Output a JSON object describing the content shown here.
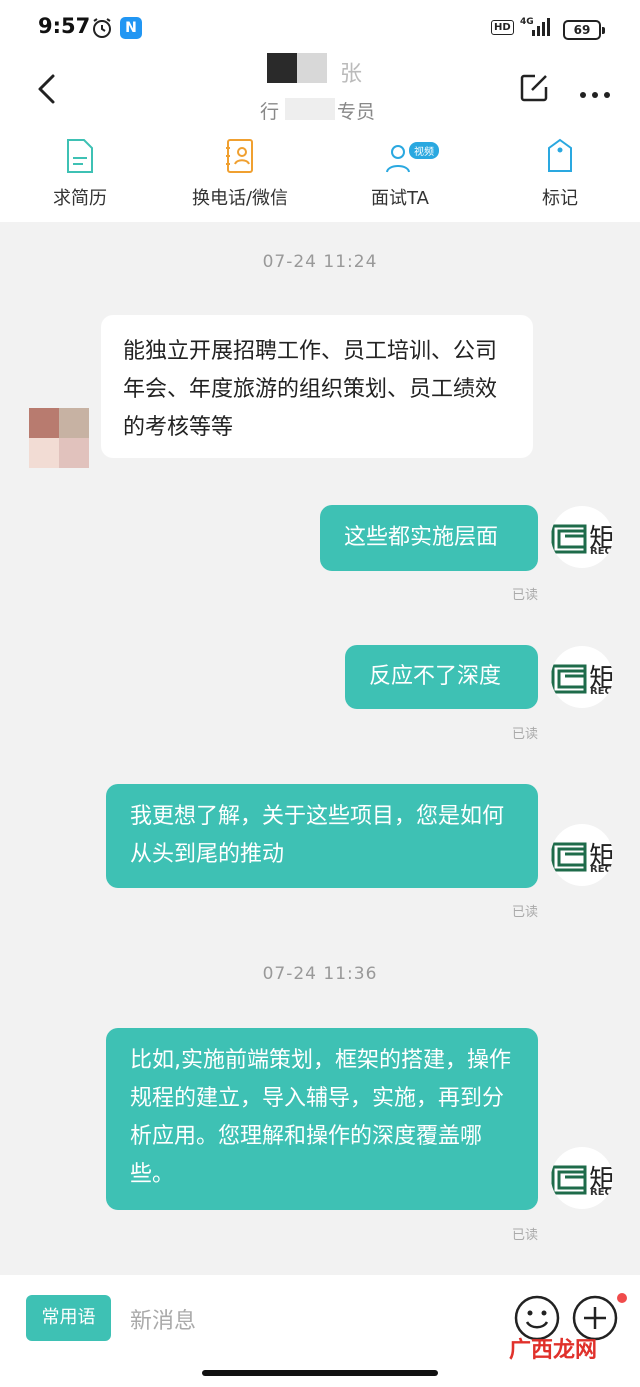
{
  "status_bar": {
    "time": "9:57",
    "n_app": "N",
    "hd": "HD",
    "network": "4G",
    "battery": "69"
  },
  "header": {
    "name_tail": "张",
    "subtitle_head": "行",
    "subtitle_tail": "专员"
  },
  "actions": [
    {
      "label": "求简历"
    },
    {
      "label": "换电话/微信"
    },
    {
      "label": "面试TA",
      "badge": "视频"
    },
    {
      "label": "标记"
    }
  ],
  "messages": {
    "ts1": "07-24 11:24",
    "incoming1": "能独立开展招聘工作、员工培训、公司年会、年度旅游的组织策划、员工绩效的考核等等",
    "out1": "这些都实施层面",
    "out2": "反应不了深度",
    "out3": "我更想了解，关于这些项目，您是如何从头到尾的推动",
    "ts2": "07-24 11:36",
    "out4": "比如,实施前端策划，框架的搭建，操作规程的建立，导入辅导，实施，再到分析应用。您理解和操作的深度覆盖哪些。",
    "read_label": "已读"
  },
  "my_avatar": {
    "char": "矩",
    "sub": "REC"
  },
  "bottom": {
    "phrase_button": "常用语",
    "input_placeholder": "新消息"
  },
  "watermark": "广西龙网",
  "colors": {
    "accent": "#3ec1b4",
    "badge": "#2aa8e0",
    "red_dot": "#f04b4b"
  }
}
